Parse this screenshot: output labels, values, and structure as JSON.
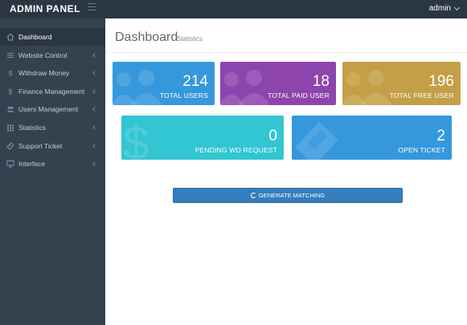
{
  "header": {
    "brand": "ADMIN PANEL",
    "user": "admin"
  },
  "sidebar": {
    "items": [
      {
        "label": "Dashboard",
        "icon": "home-icon"
      },
      {
        "label": "Website Control",
        "icon": "list-icon"
      },
      {
        "label": "Withdraw Money",
        "icon": "dollar-icon"
      },
      {
        "label": "Finance Management",
        "icon": "dollar-icon"
      },
      {
        "label": "Users Management",
        "icon": "users-icon"
      },
      {
        "label": "Statistics",
        "icon": "grid-icon"
      },
      {
        "label": "Support Ticket",
        "icon": "ticket-icon"
      },
      {
        "label": "Interface",
        "icon": "monitor-icon"
      }
    ]
  },
  "main": {
    "title": "Dashboard",
    "subtitle": "Statistics",
    "stats": [
      {
        "value": "214",
        "label": "TOTAL USERS",
        "color": "#3598dc"
      },
      {
        "value": "18",
        "label": "TOTAL PAID USER",
        "color": "#8e44ad"
      },
      {
        "value": "196",
        "label": "TOTAL FREE USER",
        "color": "#c49f47"
      },
      {
        "value": "0",
        "label": "PENDING WD REQUEST",
        "color": "#32c5d2"
      },
      {
        "value": "2",
        "label": "OPEN TICKET",
        "color": "#3598dc"
      }
    ],
    "generate_label": "GENERATE MATCHING"
  }
}
